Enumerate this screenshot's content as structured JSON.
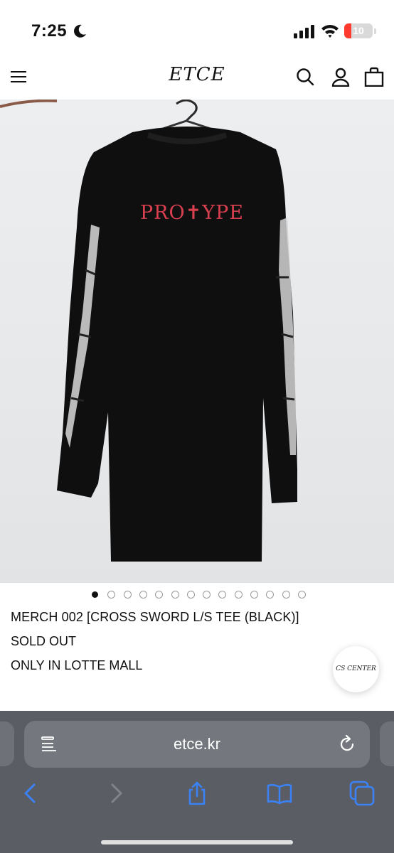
{
  "status_bar": {
    "time": "7:25",
    "battery_level": "10",
    "battery_color": "#ff3b30",
    "icons": [
      "moon-icon",
      "signal-icon",
      "wifi-icon",
      "battery-icon"
    ]
  },
  "header": {
    "logo": "ETCE",
    "icons": [
      "menu-icon",
      "search-icon",
      "account-icon",
      "bag-icon"
    ]
  },
  "product": {
    "image_print_text": "PRO✝YPE",
    "carousel": {
      "total_slides": 14,
      "active_index": 0
    },
    "title": "MERCH 002 [CROSS SWORD L/S TEE (BLACK)]",
    "status": "SOLD OUT",
    "note": "ONLY IN LOTTE MALL"
  },
  "cs_button": {
    "label": "CS CENTER"
  },
  "browser": {
    "address": "etce.kr",
    "toolbar_icons": [
      "back-icon",
      "forward-icon",
      "share-icon",
      "bookmarks-icon",
      "tabs-icon"
    ],
    "accent_color": "#3b82f6"
  }
}
